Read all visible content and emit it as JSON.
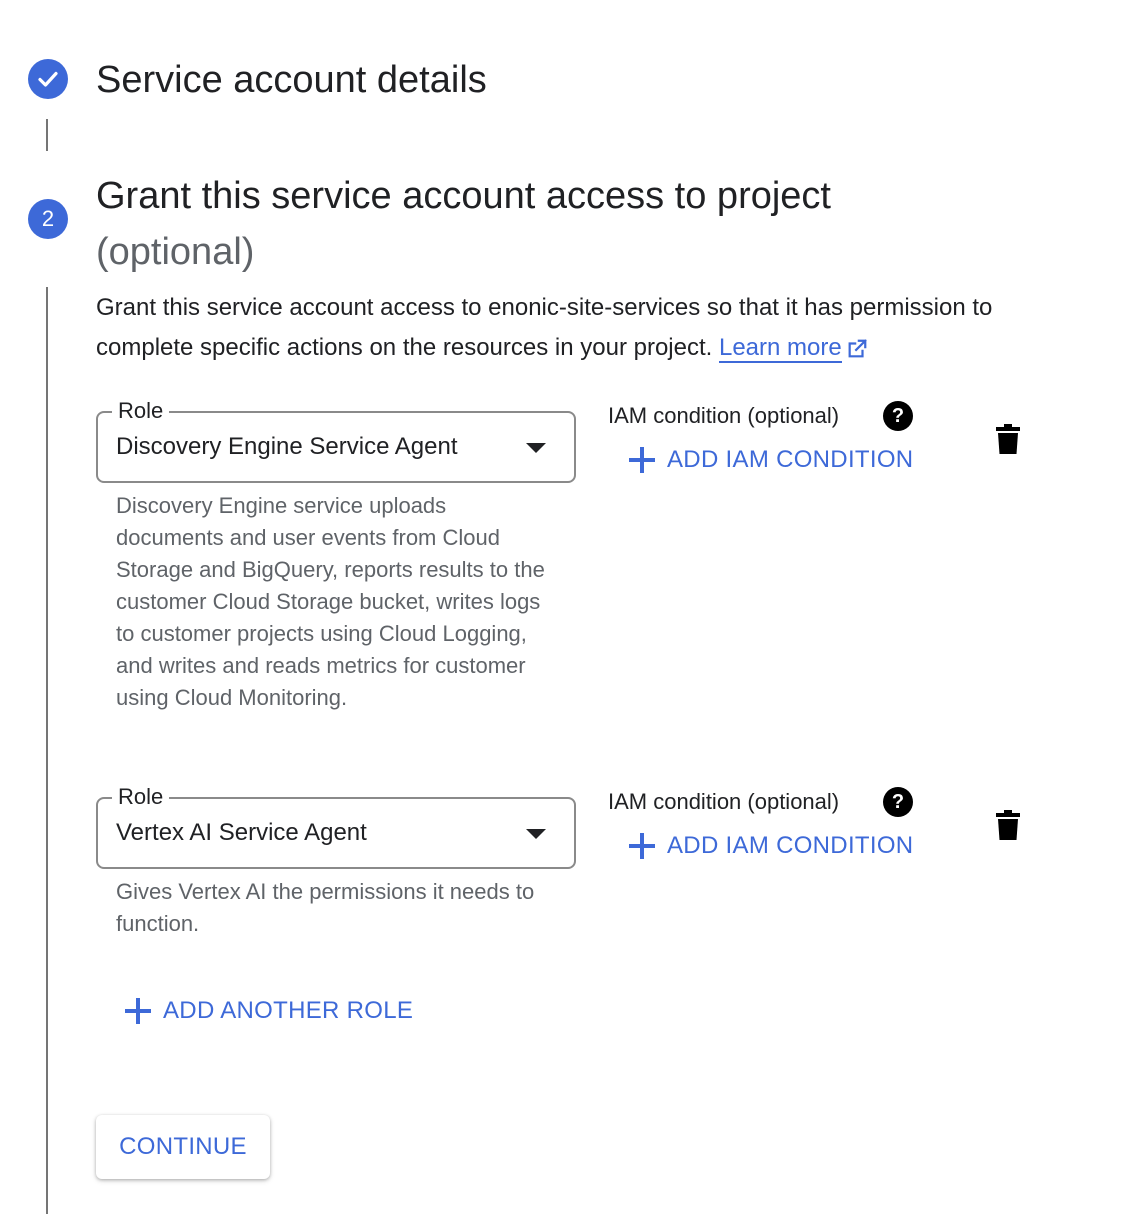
{
  "steps": [
    {
      "title": "Service account details",
      "status": "complete",
      "icon": "check-icon"
    },
    {
      "number": "2",
      "title": "Grant this service account access to project",
      "title_optional": "(optional)",
      "description": "Grant this service account access to enonic-site-services so that it has permission to complete specific actions on the resources in your project.",
      "learn_more": "Learn more"
    }
  ],
  "roles": [
    {
      "label": "Role",
      "value": "Discovery Engine Service Agent",
      "description": "Discovery Engine service uploads documents and user events from Cloud Storage and BigQuery, reports results to the customer Cloud Storage bucket, writes logs to customer projects using Cloud Logging, and writes and reads metrics for customer using Cloud Monitoring.",
      "iam_label": "IAM condition (optional)",
      "add_condition": "ADD IAM CONDITION"
    },
    {
      "label": "Role",
      "value": "Vertex AI Service Agent",
      "description": "Gives Vertex AI the permissions it needs to function.",
      "iam_label": "IAM condition (optional)",
      "add_condition": "ADD IAM CONDITION"
    }
  ],
  "add_another_role": "ADD ANOTHER ROLE",
  "continue_label": "CONTINUE",
  "colors": {
    "accent": "#3d69d8",
    "text": "#202124",
    "muted": "#5f6368",
    "border": "#8a8a8a"
  }
}
